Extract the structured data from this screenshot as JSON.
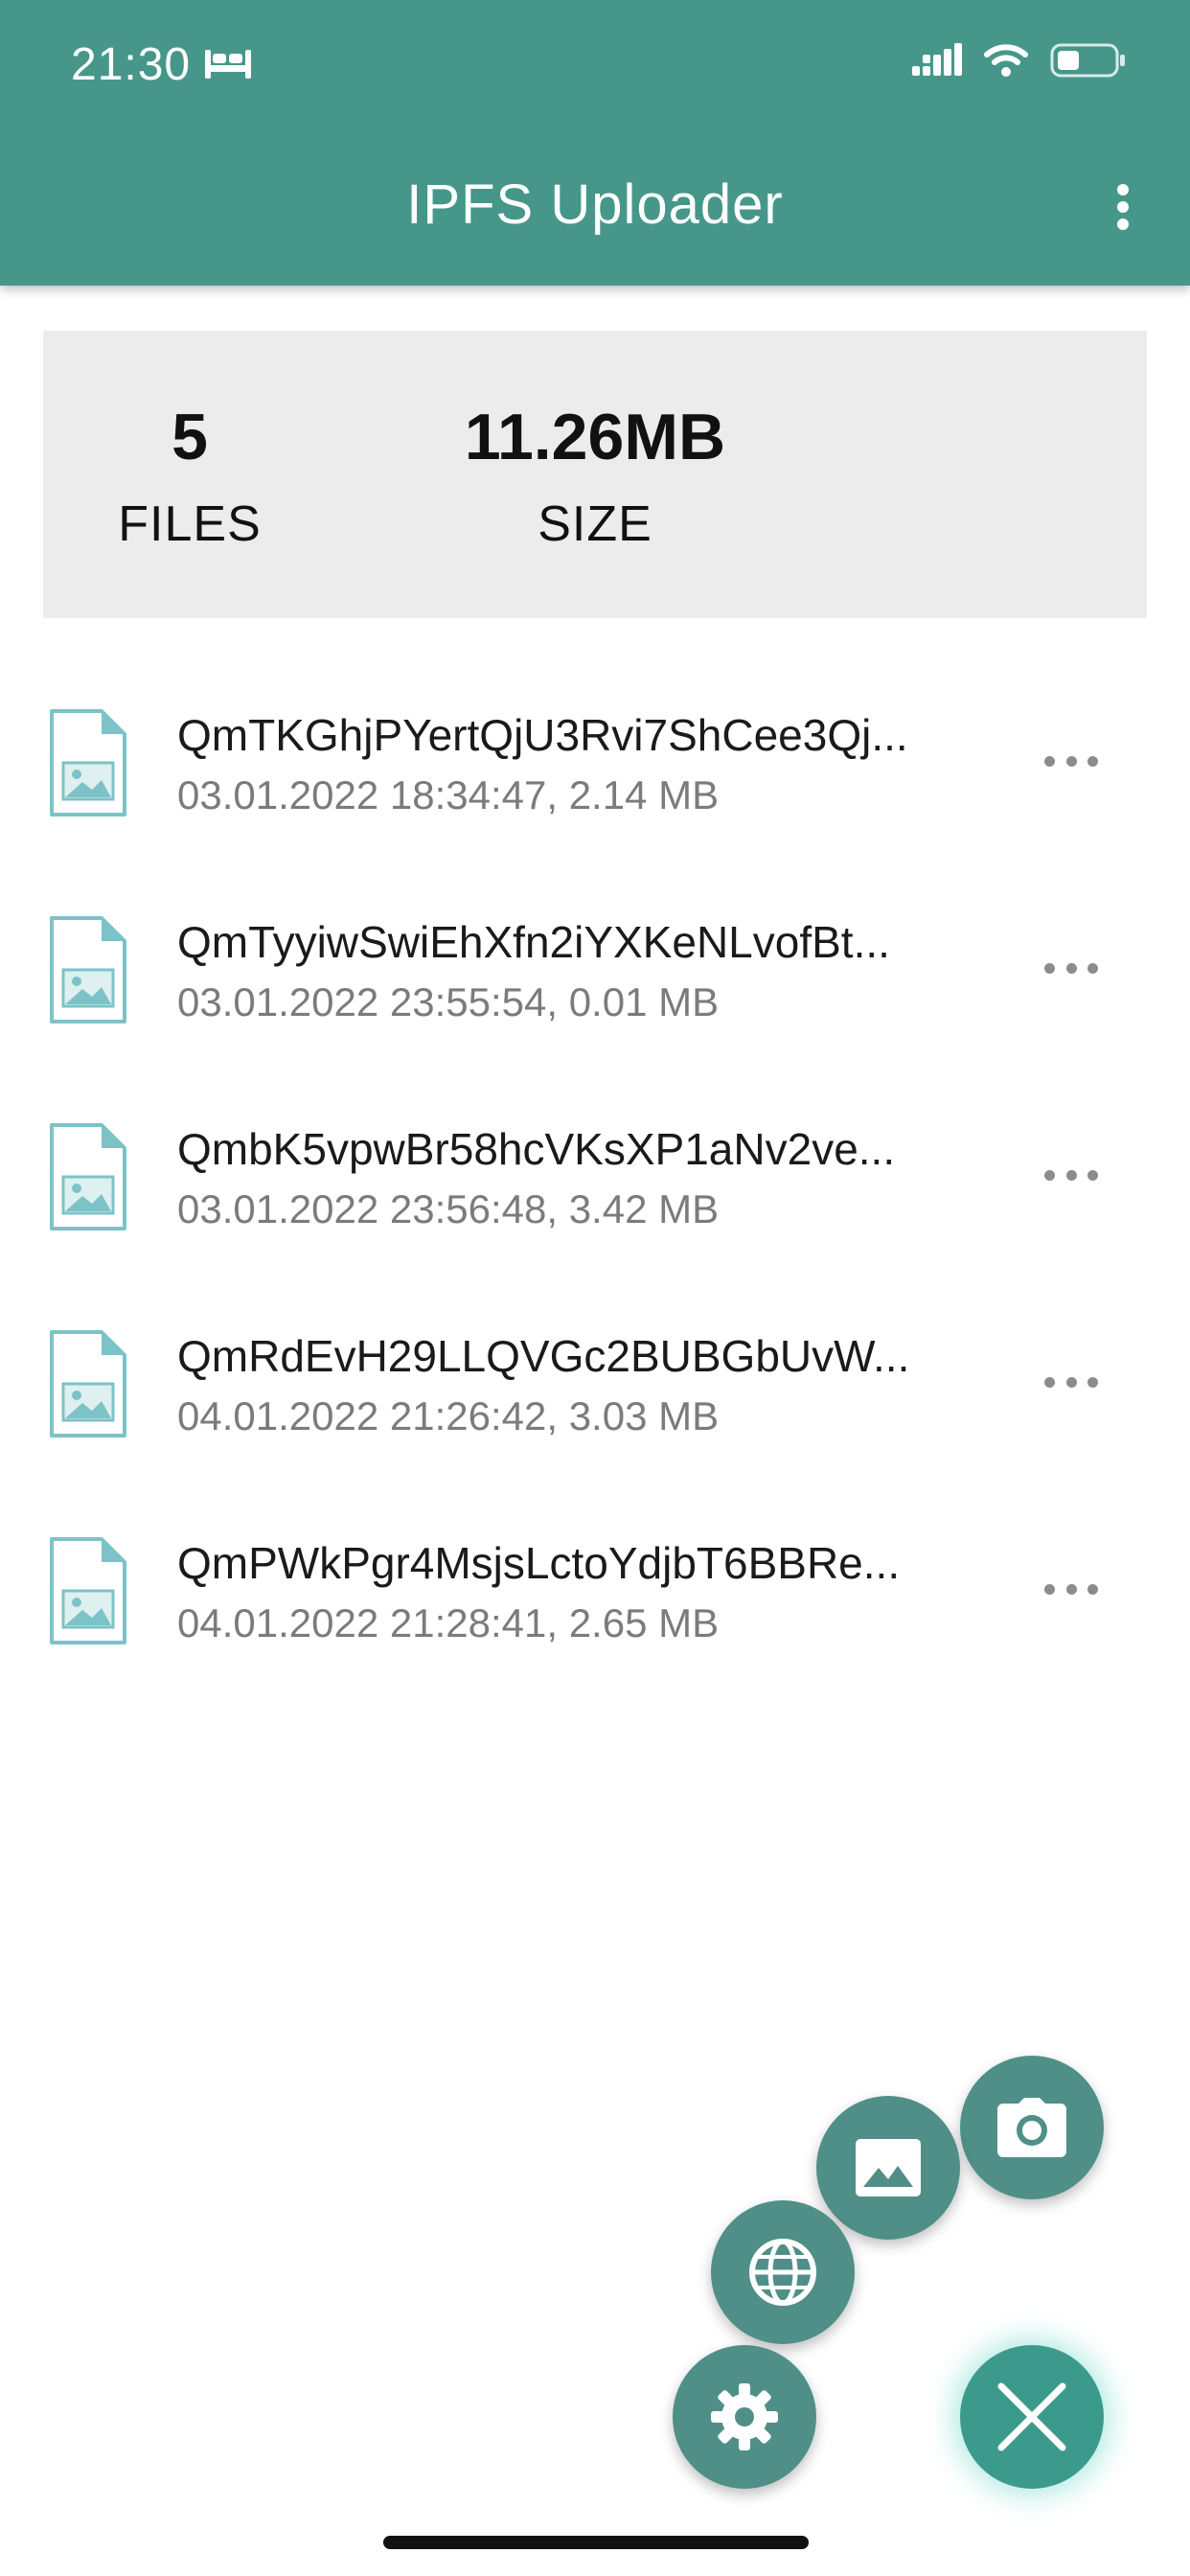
{
  "status_bar": {
    "time": "21:30"
  },
  "header": {
    "title": "IPFS Uploader"
  },
  "stats": {
    "files_count": "5",
    "files_label": "FILES",
    "size_value": "11.26MB",
    "size_label": "SIZE"
  },
  "files": [
    {
      "name": "QmTKGhjPYertQjU3Rvi7ShCee3Qj...",
      "meta": "03.01.2022 18:34:47, 2.14 MB"
    },
    {
      "name": "QmTyyiwSwiEhXfn2iYXKeNLvofBt...",
      "meta": "03.01.2022 23:55:54, 0.01 MB"
    },
    {
      "name": "QmbK5vpwBr58hcVKsXP1aNv2ve...",
      "meta": "03.01.2022 23:56:48, 3.42 MB"
    },
    {
      "name": "QmRdEvH29LLQVGc2BUBGbUvW...",
      "meta": "04.01.2022 21:26:42, 3.03 MB"
    },
    {
      "name": "QmPWkPgr4MsjsLctoYdjbT6BBRe...",
      "meta": "04.01.2022 21:28:41, 2.65 MB"
    }
  ],
  "icons": {
    "status": [
      "bed-icon",
      "signal-icon",
      "wifi-icon",
      "battery-icon"
    ],
    "header_menu": "more-vert-icon",
    "file": "image-file-icon",
    "row_menu": "more-horiz-icon",
    "fab": [
      "camera-icon",
      "image-icon",
      "globe-icon",
      "settings-icon",
      "close-icon"
    ]
  },
  "colors": {
    "header": "#46978a",
    "fab": "#4f8f87",
    "fab_close": "#3b9a8c",
    "stats_bg": "#ececec",
    "file_icon": "#7cc3c7"
  }
}
